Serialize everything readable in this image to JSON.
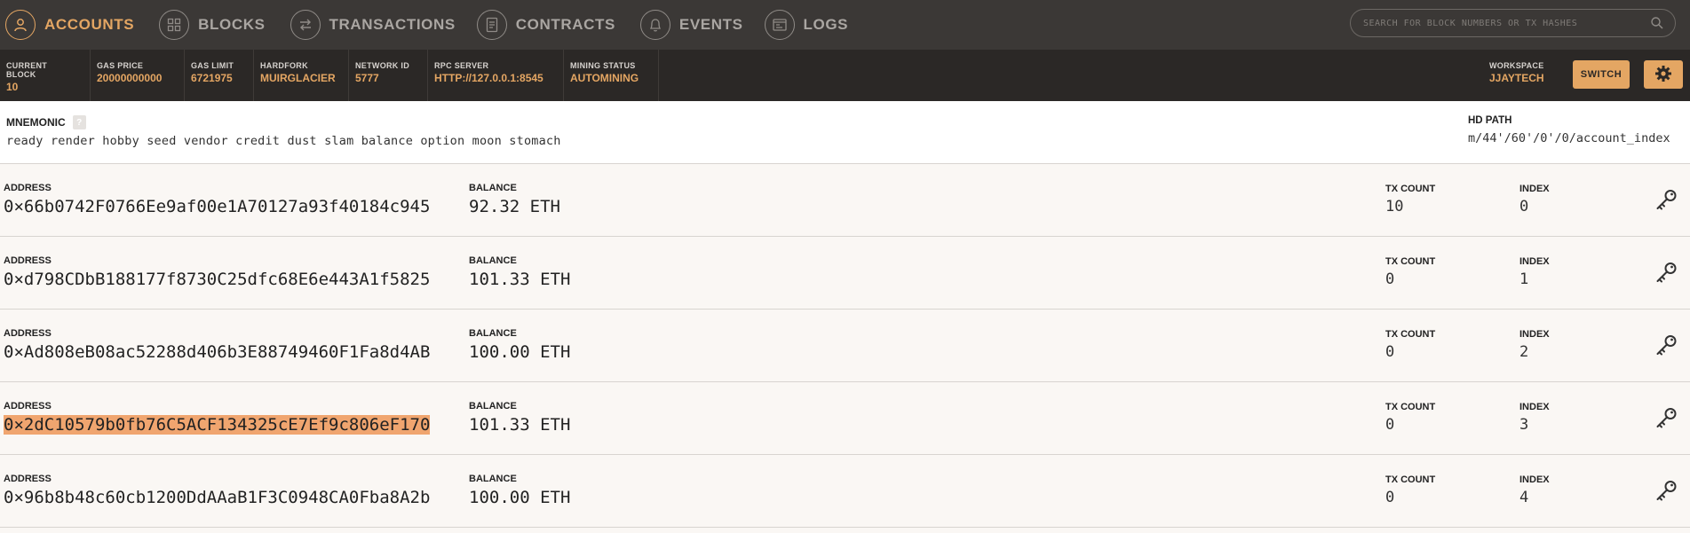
{
  "nav": {
    "items": [
      {
        "label": "ACCOUNTS",
        "icon": "person-icon",
        "active": true
      },
      {
        "label": "BLOCKS",
        "icon": "blocks-grid-icon",
        "active": false
      },
      {
        "label": "TRANSACTIONS",
        "icon": "swap-arrows-icon",
        "active": false
      },
      {
        "label": "CONTRACTS",
        "icon": "document-icon",
        "active": false
      },
      {
        "label": "EVENTS",
        "icon": "bell-icon",
        "active": false
      },
      {
        "label": "LOGS",
        "icon": "terminal-window-icon",
        "active": false
      }
    ],
    "search_placeholder": "SEARCH FOR BLOCK NUMBERS OR TX HASHES"
  },
  "status": {
    "current_block_label": "CURRENT BLOCK",
    "current_block": "10",
    "gas_price_label": "GAS PRICE",
    "gas_price": "20000000000",
    "gas_limit_label": "GAS LIMIT",
    "gas_limit": "6721975",
    "hardfork_label": "HARDFORK",
    "hardfork": "MUIRGLACIER",
    "network_id_label": "NETWORK ID",
    "network_id": "5777",
    "rpc_server_label": "RPC SERVER",
    "rpc_server": "HTTP://127.0.0.1:8545",
    "mining_status_label": "MINING STATUS",
    "mining_status": "AUTOMINING",
    "workspace_label": "WORKSPACE",
    "workspace": "JJAYTECH",
    "switch_label": "SWITCH"
  },
  "mnemonic": {
    "label": "MNEMONIC",
    "help": "?",
    "words": "ready render hobby seed vendor credit dust slam balance option moon stomach",
    "hd_path_label": "HD PATH",
    "hd_path": "m/44'/60'/0'/0/account_index"
  },
  "account_labels": {
    "address": "ADDRESS",
    "balance": "BALANCE",
    "tx_count": "TX COUNT",
    "index": "INDEX"
  },
  "accounts": [
    {
      "address": "0×66b0742F0766Ee9af00e1A70127a93f40184c945",
      "balance": "92.32 ETH",
      "tx_count": "10",
      "index": "0",
      "selected": false
    },
    {
      "address": "0×d798CDbB188177f8730C25dfc68E6e443A1f5825",
      "balance": "101.33 ETH",
      "tx_count": "0",
      "index": "1",
      "selected": false
    },
    {
      "address": "0×Ad808eB08ac52288d406b3E88749460F1Fa8d4AB",
      "balance": "100.00 ETH",
      "tx_count": "0",
      "index": "2",
      "selected": false
    },
    {
      "address": "0×2dC10579b0fb76C5ACF134325cE7Ef9c806eF170",
      "balance": "101.33 ETH",
      "tx_count": "0",
      "index": "3",
      "selected": true
    },
    {
      "address": "0×96b8b48c60cb1200DdAAaB1F3C0948CA0Fba8A2b",
      "balance": "100.00 ETH",
      "tx_count": "0",
      "index": "4",
      "selected": false
    }
  ],
  "colors": {
    "accent": "#e4a663",
    "nav_bg": "#3b3836",
    "status_bg": "#2b2826",
    "selection": "#f0a56f"
  }
}
